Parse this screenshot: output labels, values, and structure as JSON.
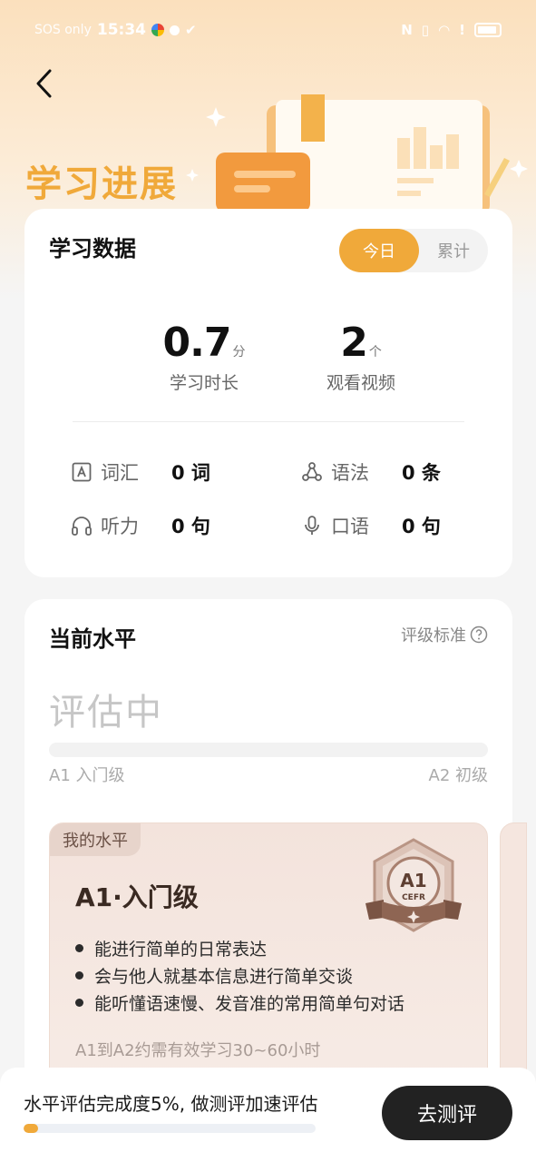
{
  "status_bar": {
    "carrier": "SOS only",
    "time": "15:34"
  },
  "header": {
    "title": "学习进展"
  },
  "study_data": {
    "title": "学习数据",
    "tabs": [
      {
        "label": "今日",
        "active": true
      },
      {
        "label": "累计",
        "active": false
      }
    ],
    "stats": [
      {
        "value": "0.7",
        "unit": "分",
        "label": "学习时长"
      },
      {
        "value": "2",
        "unit": "个",
        "label": "观看视频"
      }
    ],
    "metrics": [
      {
        "name": "词汇",
        "value": "0 词",
        "icon": "vocabulary-icon"
      },
      {
        "name": "语法",
        "value": "0 条",
        "icon": "grammar-icon"
      },
      {
        "name": "听力",
        "value": "0 句",
        "icon": "headphones-icon"
      },
      {
        "name": "口语",
        "value": "0 句",
        "icon": "microphone-icon"
      }
    ]
  },
  "current_level": {
    "title": "当前水平",
    "standard_link": "评级标准",
    "status": "评估中",
    "progress_fraction": 0,
    "range_start": "A1 入门级",
    "range_end": "A2 初级",
    "card": {
      "tag": "我的水平",
      "level_name": "A1·入门级",
      "badge_level": "A1",
      "badge_sub": "CEFR",
      "bullets": [
        "能进行简单的日常表达",
        "会与他人就基本信息进行简单交谈",
        "能听懂语速慢、发音准的常用简单句对话"
      ],
      "duration_note": "A1到A2约需有效学习30~60小时"
    }
  },
  "bottom_bar": {
    "text": "水平评估完成度5%, 做测评加速评估",
    "progress_percent": 5,
    "button_label": "去测评"
  },
  "colors": {
    "accent": "#f0a93a",
    "button_dark": "#222222"
  }
}
